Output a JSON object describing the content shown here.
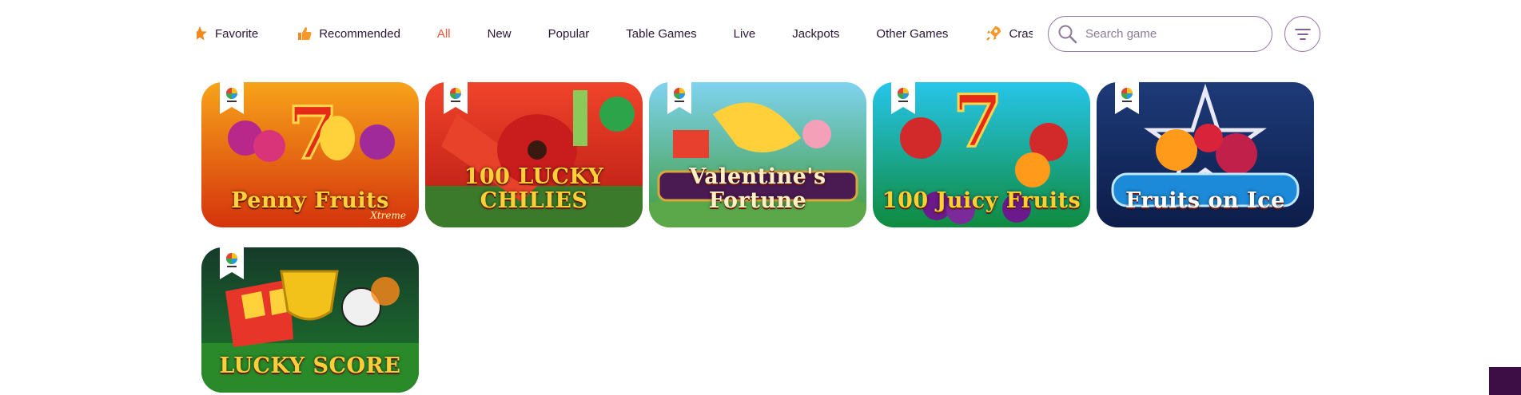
{
  "nav": {
    "tabs": [
      {
        "label": "Favorite",
        "icon": "star-icon",
        "active": false
      },
      {
        "label": "Recommended",
        "icon": "thumbs-up-icon",
        "active": false
      },
      {
        "label": "All",
        "icon": "",
        "active": true
      },
      {
        "label": "New",
        "icon": "",
        "active": false
      },
      {
        "label": "Popular",
        "icon": "",
        "active": false
      },
      {
        "label": "Table Games",
        "icon": "",
        "active": false
      },
      {
        "label": "Live",
        "icon": "",
        "active": false
      },
      {
        "label": "Jackpots",
        "icon": "",
        "active": false
      },
      {
        "label": "Other Games",
        "icon": "",
        "active": false
      },
      {
        "label": "Crash games",
        "icon": "rocket-icon",
        "active": false
      }
    ]
  },
  "search": {
    "placeholder": "Search game",
    "value": ""
  },
  "filter": {
    "icon": "filter-icon"
  },
  "games": [
    {
      "title": "Penny Fruits",
      "subtitle": "Xtreme",
      "provider_badge": "provider-logo-icon",
      "bg": [
        "#f7a31a",
        "#d5330c"
      ],
      "text_color": "#ffd23c"
    },
    {
      "title": "100 LUCKY CHILIES",
      "subtitle": "",
      "provider_badge": "provider-logo-icon",
      "bg": [
        "#f0432a",
        "#b51a12"
      ],
      "text_color": "#ffcf3a"
    },
    {
      "title": "Valentine's Fortune",
      "subtitle": "",
      "provider_badge": "provider-logo-icon",
      "bg": [
        "#7fd3f0",
        "#3f9a3a"
      ],
      "text_color": "#fff0c6"
    },
    {
      "title": "100 Juicy Fruits",
      "subtitle": "",
      "provider_badge": "provider-logo-icon",
      "bg": [
        "#27c6ea",
        "#0f8a3e"
      ],
      "text_color": "#ffd12e"
    },
    {
      "title": "Fruits on Ice",
      "subtitle": "",
      "provider_badge": "provider-logo-icon",
      "bg": [
        "#1d3a78",
        "#0d1d4a"
      ],
      "text_color": "#ffffff"
    },
    {
      "title": "LUCKY SCORE",
      "subtitle": "",
      "provider_badge": "provider-logo-icon",
      "bg": [
        "#153b2a",
        "#1e7a2c"
      ],
      "text_color": "#ffcf3a"
    }
  ],
  "colors": {
    "accent": "#f0563a",
    "text": "#2a1536",
    "border": "#9b7aa8",
    "corner_block": "#3d0d45"
  }
}
